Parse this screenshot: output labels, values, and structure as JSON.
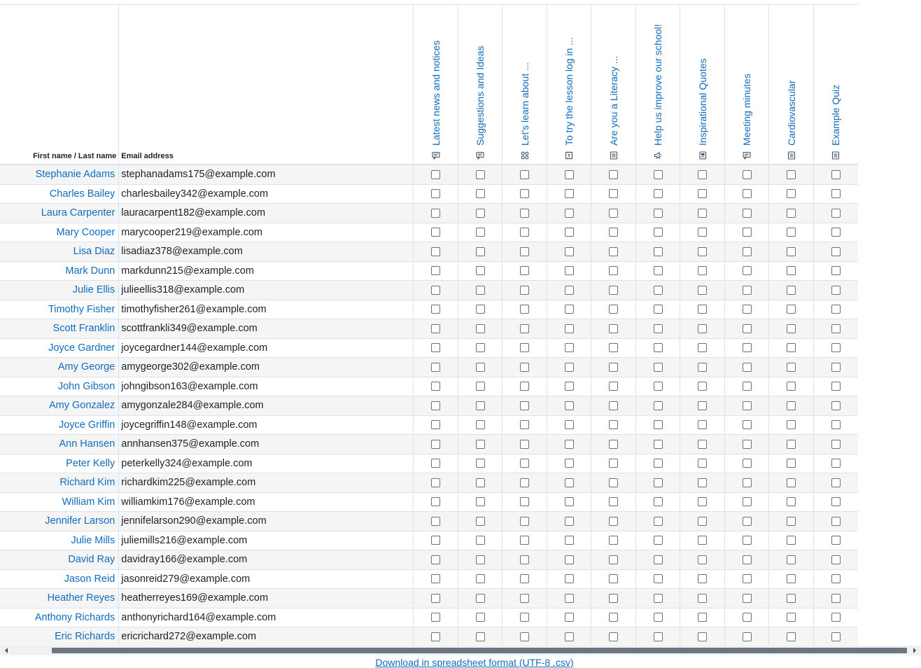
{
  "table": {
    "name_header": "First name / Last name",
    "email_header": "Email address",
    "activities": [
      {
        "label": "Latest news and notices",
        "icon": "forum-icon"
      },
      {
        "label": "Suggestions and Ideas",
        "icon": "forum-icon"
      },
      {
        "label": "Let's learn about ...",
        "icon": "workshop-icon"
      },
      {
        "label": "To try the lesson log in ...",
        "icon": "lesson-icon"
      },
      {
        "label": "Are you a Literacy ...",
        "icon": "page-icon"
      },
      {
        "label": "Help us improve our school!",
        "icon": "feedback-icon"
      },
      {
        "label": "Inspirational Quotes",
        "icon": "book-icon"
      },
      {
        "label": "Meeting minutes",
        "icon": "forum-icon"
      },
      {
        "label": "Cardiovascular",
        "icon": "page-icon"
      },
      {
        "label": "Example Quiz",
        "icon": "page-icon"
      }
    ],
    "rows": [
      {
        "name": "Stephanie Adams",
        "email": "stephanadams175@example.com"
      },
      {
        "name": "Charles Bailey",
        "email": "charlesbailey342@example.com"
      },
      {
        "name": "Laura Carpenter",
        "email": "lauracarpent182@example.com"
      },
      {
        "name": "Mary Cooper",
        "email": "marycooper219@example.com"
      },
      {
        "name": "Lisa Diaz",
        "email": "lisadiaz378@example.com"
      },
      {
        "name": "Mark Dunn",
        "email": "markdunn215@example.com"
      },
      {
        "name": "Julie Ellis",
        "email": "julieellis318@example.com"
      },
      {
        "name": "Timothy Fisher",
        "email": "timothyfisher261@example.com"
      },
      {
        "name": "Scott Franklin",
        "email": "scottfrankli349@example.com"
      },
      {
        "name": "Joyce Gardner",
        "email": "joycegardner144@example.com"
      },
      {
        "name": "Amy George",
        "email": "amygeorge302@example.com"
      },
      {
        "name": "John Gibson",
        "email": "johngibson163@example.com"
      },
      {
        "name": "Amy Gonzalez",
        "email": "amygonzale284@example.com"
      },
      {
        "name": "Joyce Griffin",
        "email": "joycegriffin148@example.com"
      },
      {
        "name": "Ann Hansen",
        "email": "annhansen375@example.com"
      },
      {
        "name": "Peter Kelly",
        "email": "peterkelly324@example.com"
      },
      {
        "name": "Richard Kim",
        "email": "richardkim225@example.com"
      },
      {
        "name": "William Kim",
        "email": "williamkim176@example.com"
      },
      {
        "name": "Jennifer Larson",
        "email": "jennifelarson290@example.com"
      },
      {
        "name": "Julie Mills",
        "email": "juliemills216@example.com"
      },
      {
        "name": "David Ray",
        "email": "davidray166@example.com"
      },
      {
        "name": "Jason Reid",
        "email": "jasonreid279@example.com"
      },
      {
        "name": "Heather Reyes",
        "email": "heatherreyes169@example.com"
      },
      {
        "name": "Anthony Richards",
        "email": "anthonyrichard164@example.com"
      },
      {
        "name": "Eric Richards",
        "email": "ericrichard272@example.com"
      }
    ]
  },
  "footer": {
    "download_link": "Download in spreadsheet format (UTF-8 .csv)"
  },
  "colors": {
    "link": "#0f6cbf",
    "border": "#dee2e6",
    "stripe": "#f5f5f5"
  }
}
